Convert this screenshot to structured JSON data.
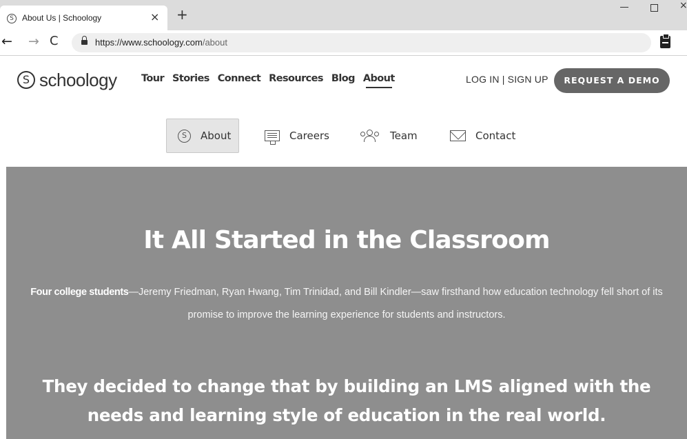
{
  "browser": {
    "tab_title": "About Us | Schoology",
    "tab_close": "×",
    "new_tab": "+",
    "win_close": "×",
    "url_host": "https://www.schoology.com",
    "url_path": "/about",
    "nav_back": "←",
    "nav_forward": "→",
    "nav_reload": "C",
    "favicon": "S"
  },
  "header": {
    "logo_mark": "S",
    "logo_text": "schoology",
    "nav": [
      "Tour",
      "Stories",
      "Connect",
      "Resources",
      "Blog",
      "About"
    ],
    "auth_link": "LOG IN | SIGN UP",
    "demo_button": "REQUEST A DEMO"
  },
  "sub_nav": {
    "items": [
      {
        "label": "About",
        "icon": "schoology-s-icon"
      },
      {
        "label": "Careers",
        "icon": "careers-board-icon"
      },
      {
        "label": "Team",
        "icon": "team-people-icon"
      },
      {
        "label": "Contact",
        "icon": "envelope-icon"
      }
    ],
    "about_glyph": "S"
  },
  "hero": {
    "title": "It All Started in the Classroom",
    "body_bold": "Four college students",
    "body_rest": "—Jeremy Friedman, Ryan Hwang, Tim Trinidad, and Bill Kindler—saw firsthand how education technology fell short of its promise to improve the learning experience for students and instructors.",
    "tagline": "They decided to change that by building an LMS aligned with the needs and learning style of education in the real world."
  },
  "colors": {
    "hero_bg": "#8e8e8e",
    "demo_button_bg": "#666666",
    "active_subnav_bg": "#e5e5e5"
  }
}
